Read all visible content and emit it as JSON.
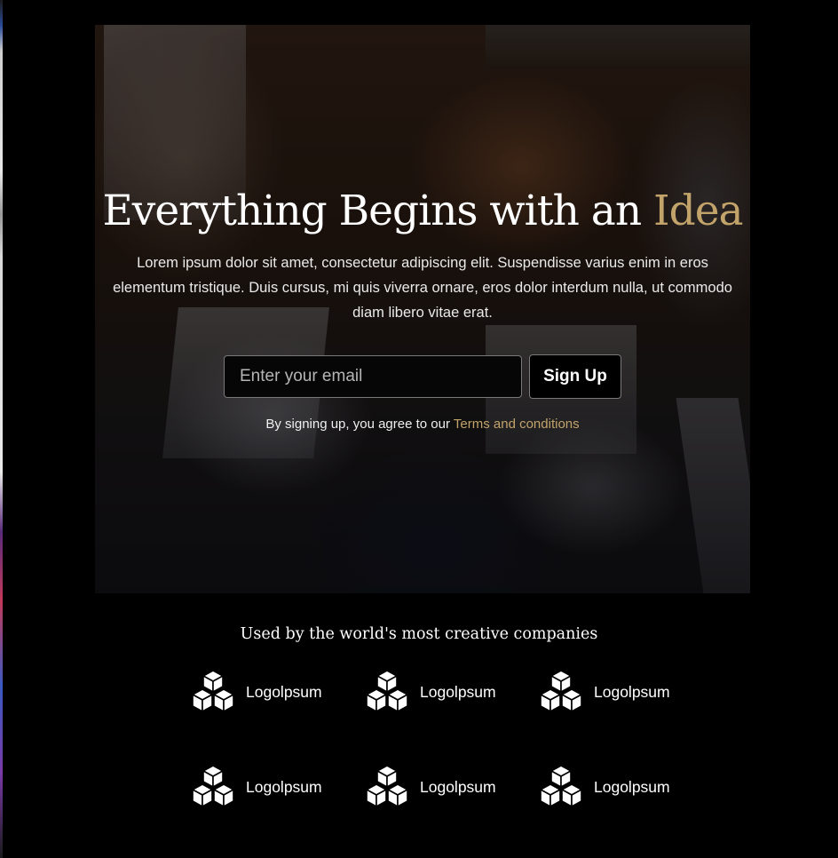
{
  "hero": {
    "title_main": "Everything Begins with an",
    "title_accent": "Idea",
    "description": "Lorem ipsum dolor sit amet, consectetur adipiscing elit. Suspendisse varius enim in eros elementum tristique. Duis cursus, mi quis viverra ornare, eros dolor interdum nulla, ut commodo diam libero vitae erat.",
    "email_placeholder": "Enter your email",
    "email_value": "",
    "signup_label": "Sign Up",
    "terms_prefix": "By signing up, you agree to our",
    "terms_link": "Terms and conditions",
    "accent_color": "#c2a46b"
  },
  "companies": {
    "heading": "Used by the world's most creative companies",
    "logos": [
      {
        "label": "Logolpsum",
        "icon": "cubes-icon"
      },
      {
        "label": "Logolpsum",
        "icon": "cubes-icon"
      },
      {
        "label": "Logolpsum",
        "icon": "cubes-icon"
      },
      {
        "label": "Logolpsum",
        "icon": "cubes-icon"
      },
      {
        "label": "Logolpsum",
        "icon": "cubes-icon"
      },
      {
        "label": "Logolpsum",
        "icon": "cubes-icon"
      }
    ]
  }
}
